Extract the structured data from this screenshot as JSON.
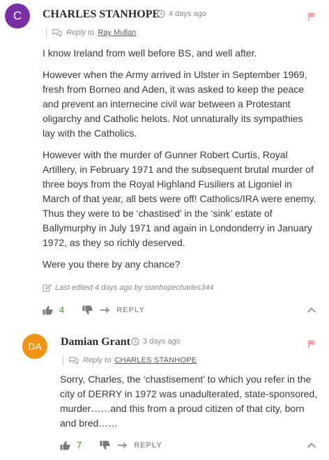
{
  "comments": [
    {
      "avatar_letter": "C",
      "avatar_color": "#7b2fa6",
      "author": "CHARLES STANHOPE",
      "time": "4 days ago",
      "reply_to_label": "Reply to",
      "reply_to_name": "Ray Mullan",
      "paragraphs": [
        "I know Ireland from well before BS, and well after.",
        "However when the Army arrived in Ulster in September 1969, fresh from Borneo and Aden, it was asked to keep the peace and prevent an internecine civil war between a Protestant oligarchy and Catholic helots. Not unnaturally its sympathies lay with the Catholics.",
        "However with the murder of Gunner Robert Curtis, Royal Artillery, in February 1971 and the subsequent brutal murder of three boys from the Royal Highland Fusiliers at Ligoniel in March of that year, all bets were off! Catholics/IRA were enemy. Thus they were to be ‘chastised’ in the ‘sink’ estate of Ballymurphy in July 1971 and again in Londonderry in January 1972, as they so richly deserved.",
        "Were you there by any chance?"
      ],
      "edited": "Last edited 4 days ago by stanhopecharles344",
      "likes": "4",
      "reply_label": "REPLY"
    },
    {
      "avatar_letter": "DA",
      "avatar_color": "#f29312",
      "author": "Damian Grant",
      "time": "3 days ago",
      "reply_to_label": "Reply to",
      "reply_to_name": "CHARLES STANHOPE",
      "paragraphs": [
        "Sorry, Charles, the ‘chastisement’ to which you refer in the city of DERRY in 1972 was unadulterated, state-sponsored, murder……and this from a proud citizen of that city, born and bred……"
      ],
      "likes": "7",
      "reply_label": "REPLY"
    }
  ],
  "colors": {
    "flag": "#f4a3a3",
    "likes": "#4a8a35",
    "icon": "#9a9a9a"
  }
}
